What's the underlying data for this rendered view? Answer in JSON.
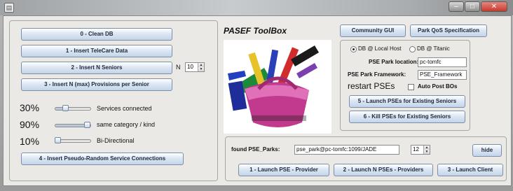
{
  "window": {
    "app_icon": "app-icon",
    "controls": [
      "–",
      "□",
      "✕"
    ]
  },
  "left_panel": {
    "buttons": [
      "0 - Clean DB",
      "1 - Insert TeleCare Data",
      "2 - Insert N Seniors",
      "3 - Insert N (max) Provisions per Senior",
      "4 - Insert Pseudo-Random Service Connections"
    ],
    "n_label": "N",
    "n_value": "10",
    "sliders": [
      {
        "percent_label": "30%",
        "value": 0.3,
        "label": "Services connected"
      },
      {
        "percent_label": "90%",
        "value": 0.9,
        "label": "same category / kind"
      },
      {
        "percent_label": "10%",
        "value": 0.1,
        "label": "Bi-Directional"
      }
    ]
  },
  "center": {
    "title": "PASEF ToolBox",
    "image": "toolbox-illustration"
  },
  "top_right_buttons": {
    "community_gui": "Community GUI",
    "park_qos": "Park QoS Specification"
  },
  "pse_panel": {
    "radio_localhost": "DB @ Local Host",
    "radio_titanic": "DB @ Titanic",
    "selected_radio": "localhost",
    "park_location_label": "PSE Park location:",
    "park_location_value": "pc-tomfc",
    "park_framework_label": "PSE Park Framework:",
    "park_framework_value": "PSE_Framework",
    "restart_label": "restart PSEs",
    "auto_post_label": "Auto Post BOs",
    "auto_post_checked": false,
    "launch_button": "5 - Launch PSEs for Existing Seniors",
    "kill_button": "6 - Kill PSEs for Existing Seniors"
  },
  "bottom_panel": {
    "found_label": "found PSE_Parks:",
    "found_value": "pse_park@pc-tomfc:1099/JADE",
    "count_value": "12",
    "hide_button": "hide",
    "launch_provider": "1 - Launch PSE - Provider",
    "launch_n_providers": "2 - Launch N PSEs - Providers",
    "launch_client": "3 - Launch Client"
  }
}
